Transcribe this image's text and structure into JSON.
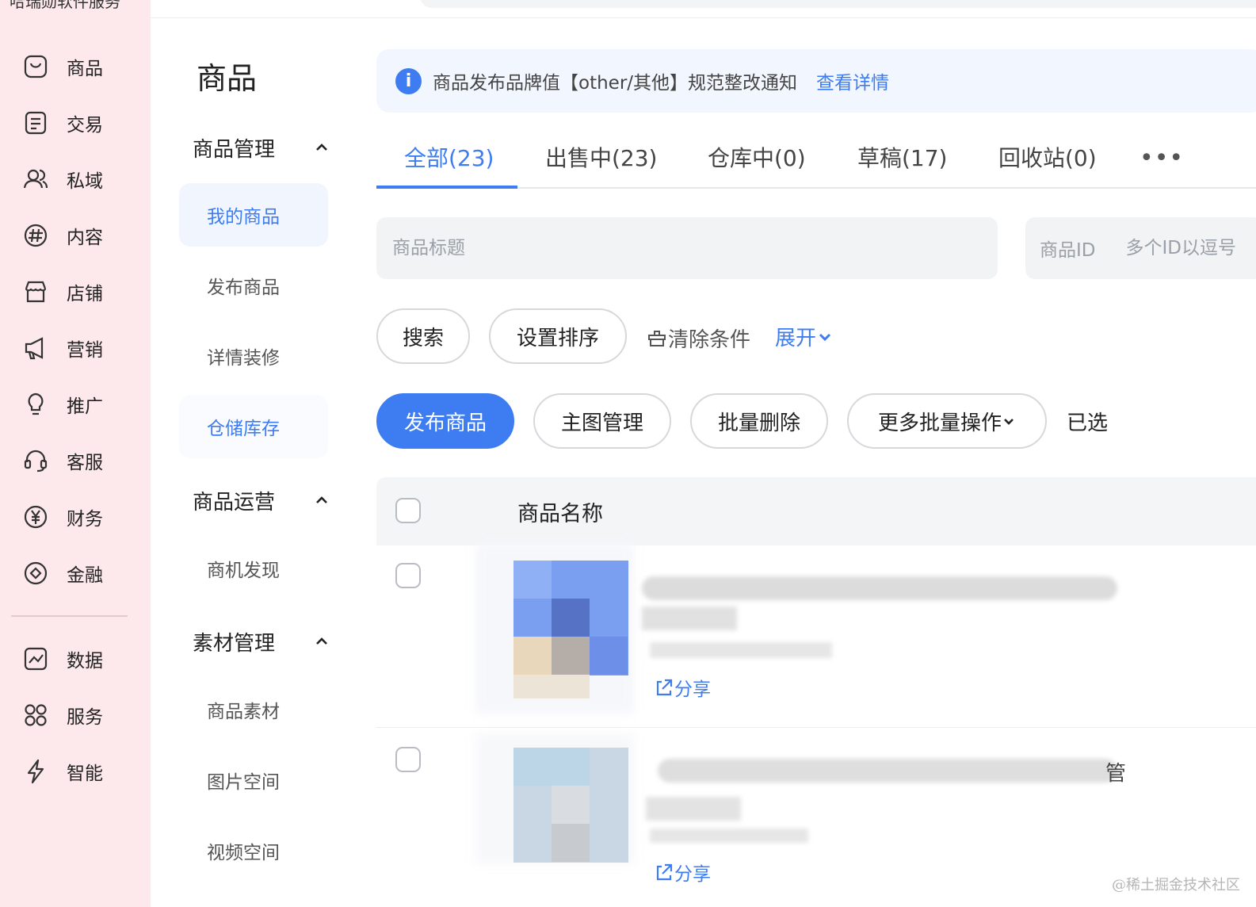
{
  "app": {
    "title": "哈瑞勋软件服务"
  },
  "colors": {
    "accent": "#3d7cf1",
    "nav_bg": "#fde8ec"
  },
  "leftnav": {
    "items": [
      {
        "label": "商品",
        "icon": "bag-icon"
      },
      {
        "label": "交易",
        "icon": "order-list-icon"
      },
      {
        "label": "私域",
        "icon": "users-icon"
      },
      {
        "label": "内容",
        "icon": "hashtag-icon"
      },
      {
        "label": "店铺",
        "icon": "store-icon"
      },
      {
        "label": "营销",
        "icon": "megaphone-icon"
      },
      {
        "label": "推广",
        "icon": "lightbulb-icon"
      },
      {
        "label": "客服",
        "icon": "headset-icon"
      },
      {
        "label": "财务",
        "icon": "yuan-icon"
      },
      {
        "label": "金融",
        "icon": "finance-icon"
      },
      {
        "label": "数据",
        "icon": "chart-icon"
      },
      {
        "label": "服务",
        "icon": "grid-icon"
      },
      {
        "label": "智能",
        "icon": "lightning-icon"
      }
    ]
  },
  "sidebar": {
    "title": "商品",
    "groups": [
      {
        "label": "商品管理",
        "items": [
          "我的商品",
          "发布商品",
          "详情装修",
          "仓储库存"
        ]
      },
      {
        "label": "商品运营",
        "items": [
          "商机发现"
        ]
      },
      {
        "label": "素材管理",
        "items": [
          "商品素材",
          "图片空间",
          "视频空间"
        ]
      }
    ]
  },
  "notice": {
    "icon": "info-icon",
    "text": "商品发布品牌值【other/其他】规范整改通知",
    "link": "查看详情"
  },
  "tabs": [
    {
      "label": "全部(23)"
    },
    {
      "label": "出售中(23)"
    },
    {
      "label": "仓库中(0)"
    },
    {
      "label": "草稿(17)"
    },
    {
      "label": "回收站(0)"
    }
  ],
  "tabs_more": "•••",
  "search": {
    "title_placeholder": "商品标题",
    "id_label": "商品ID",
    "id_placeholder": "多个ID以逗号"
  },
  "filter_buttons": {
    "search": "搜索",
    "sort": "设置排序",
    "clear": "清除条件",
    "expand": "展开"
  },
  "actions": {
    "publish": "发布商品",
    "main_image": "主图管理",
    "batch_delete": "批量删除",
    "more_batch": "更多批量操作",
    "selected": "已选"
  },
  "table": {
    "col_name": "商品名称",
    "rows": [
      {
        "share": "分享"
      },
      {
        "share": "分享",
        "partial_title": "管"
      }
    ]
  },
  "watermark": "@稀土掘金技术社区"
}
